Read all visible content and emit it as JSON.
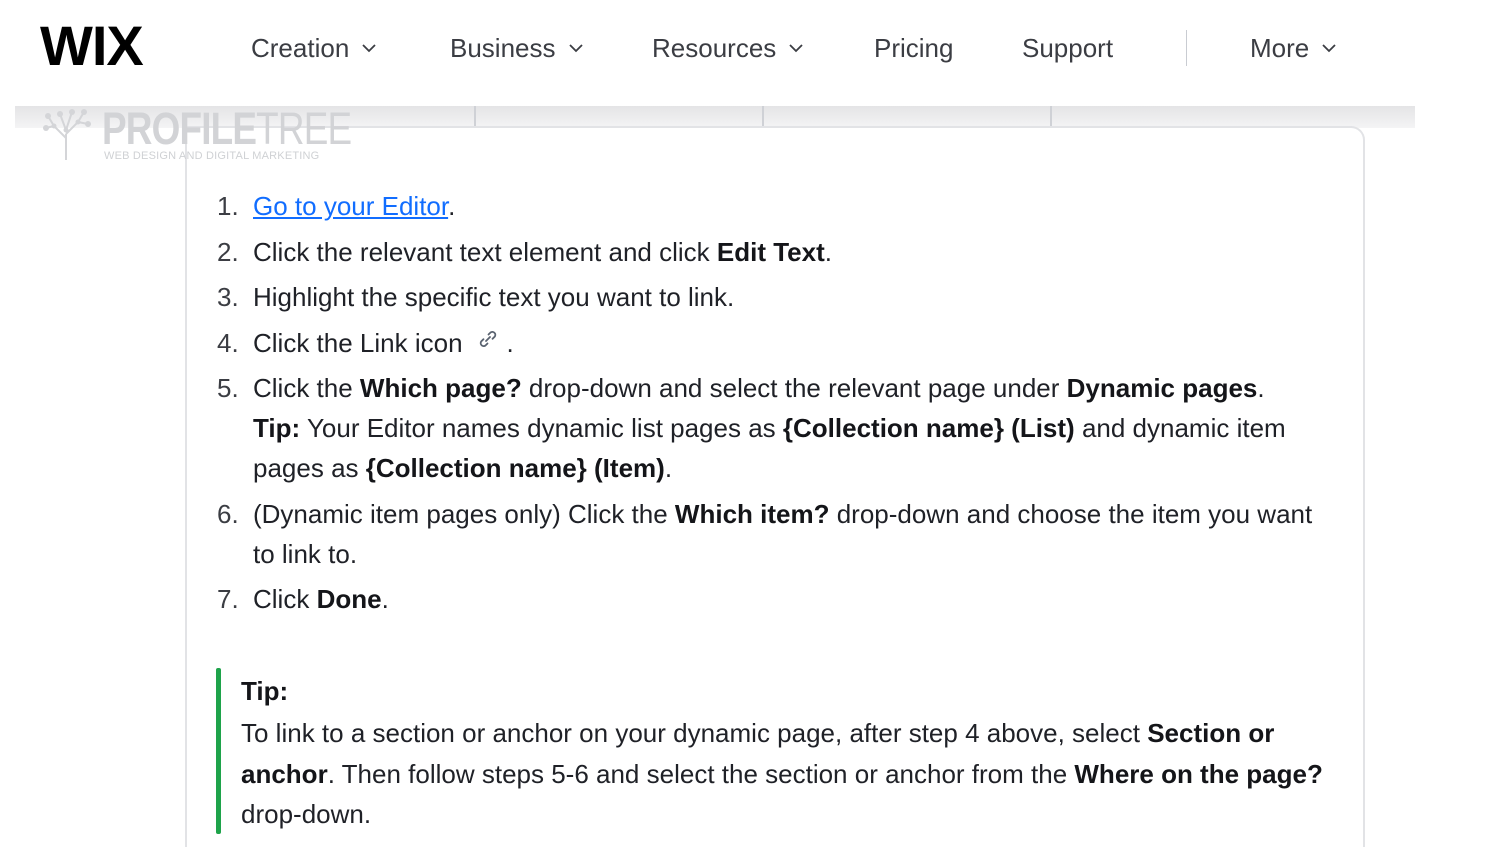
{
  "header": {
    "logo": "WIX",
    "nav": [
      {
        "label": "Creation",
        "has_chevron": true
      },
      {
        "label": "Business",
        "has_chevron": true
      },
      {
        "label": "Resources",
        "has_chevron": true
      },
      {
        "label": "Pricing",
        "has_chevron": false
      },
      {
        "label": "Support",
        "has_chevron": false
      },
      {
        "label": "More",
        "has_chevron": true
      }
    ]
  },
  "watermark": {
    "brand_bold": "PROFILE",
    "brand_light": "TREE",
    "tagline": "WEB DESIGN AND DIGITAL MARKETING"
  },
  "steps": [
    {
      "num": "1.",
      "link": "Go to your Editor",
      "after": "."
    },
    {
      "num": "2.",
      "pre": "Click the relevant text element and click ",
      "bold": "Edit Text",
      "after": "."
    },
    {
      "num": "3.",
      "text": "Highlight the specific text you want to link."
    },
    {
      "num": "4.",
      "pre": "Click the Link icon",
      "icon": "link-icon",
      "after": "."
    },
    {
      "num": "5.",
      "pre": "Click the ",
      "bold1": "Which page?",
      "mid": " drop-down and select the relevant page under ",
      "bold2": "Dynamic pages",
      "after": ".",
      "tip_label": "Tip:",
      "tip_pre": " Your Editor names dynamic list pages as ",
      "tip_bold1": "{Collection name} (List)",
      "tip_mid": " and dynamic item pages as ",
      "tip_bold2": "{Collection name} (Item)",
      "tip_after": "."
    },
    {
      "num": "6.",
      "pre": "(Dynamic item pages only) Click the ",
      "bold": "Which item?",
      "after": " drop-down and choose the item you want to link to."
    },
    {
      "num": "7.",
      "pre": "Click ",
      "bold": "Done",
      "after": "."
    }
  ],
  "tip": {
    "title": "Tip:",
    "pre": "To link to a section or anchor on your dynamic page, after step 4 above, select ",
    "bold1": "Section or anchor",
    "mid": ". Then follow steps 5-6 and select the section or anchor from the ",
    "bold2": "Where on the page?",
    "after": " drop-down."
  },
  "colors": {
    "link": "#116dff",
    "tip_bar": "#1ea34a",
    "text": "#1f2127"
  }
}
